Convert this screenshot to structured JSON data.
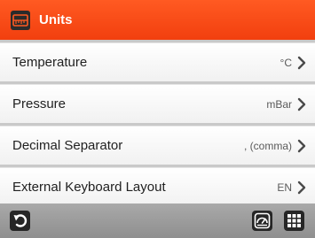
{
  "header": {
    "title": "Units",
    "icon": "ruler-icon",
    "color": "#f5461a"
  },
  "rows": [
    {
      "label": "Temperature",
      "value": "°C"
    },
    {
      "label": "Pressure",
      "value": "mBar"
    },
    {
      "label": "Decimal Separator",
      "value": ", (comma)"
    },
    {
      "label": "External Keyboard Layout",
      "value": "EN"
    }
  ],
  "footer": {
    "back_icon": "back-arrow-icon",
    "gauge_icon": "gauge-icon",
    "grid_icon": "grid-menu-icon"
  }
}
